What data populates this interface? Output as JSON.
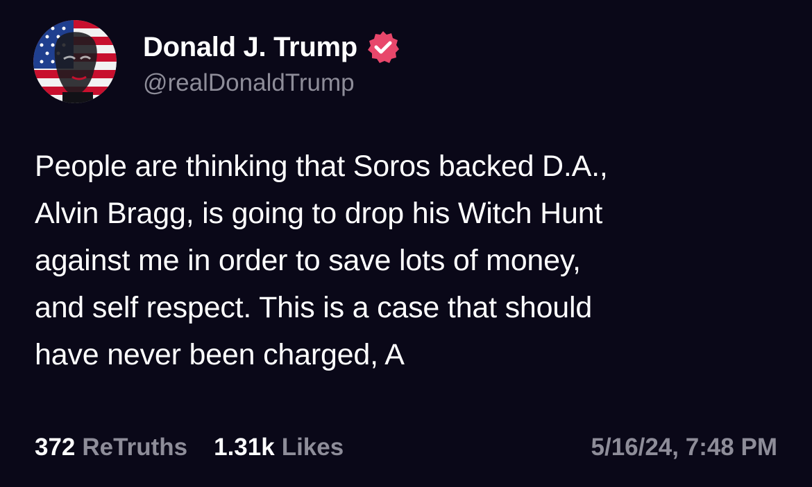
{
  "post": {
    "author": {
      "display_name": "Donald J. Trump",
      "handle": "@realDonaldTrump",
      "verified": true,
      "avatar_icon": "flag-portrait-avatar",
      "verified_icon": "verified-badge-icon",
      "verified_color": "#e8476b"
    },
    "text": "People are thinking that Soros backed D.A.,\nAlvin Bragg, is going to drop his Witch Hunt\nagainst me in order to save lots of money,\nand self respect. This is a case that should\nhave never been charged, A",
    "stats": {
      "retruths_count": "372",
      "retruths_label": "ReTruths",
      "likes_count": "1.31k",
      "likes_label": "Likes"
    },
    "timestamp": "5/16/24, 7:48 PM"
  },
  "colors": {
    "background": "#0a0818",
    "text_primary": "#ffffff",
    "text_secondary": "#8e8d99"
  }
}
